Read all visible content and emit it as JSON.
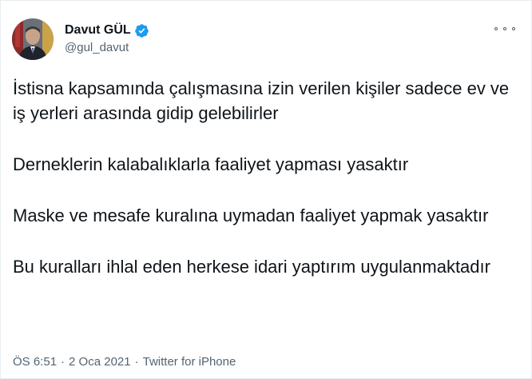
{
  "author": {
    "display_name": "Davut GÜL",
    "handle": "@gul_davut",
    "verified_badge_color": "#1d9bf0"
  },
  "more_icon": "more-horizontal-icon",
  "tweet": {
    "paragraphs": [
      "İstisna kapsamında çalışmasına izin verilen kişiler sadece ev ve iş yerleri arasında gidip gelebilirler",
      "Derneklerin kalabalıklarla faaliyet yapması yasaktır",
      "Maske ve mesafe kuralına uymadan faaliyet yapmak yasaktır",
      "Bu kuralları ihlal eden herkese idari yaptırım uygulanmaktadır"
    ],
    "time": "ÖS 6:51",
    "separator1": "·",
    "date": "2 Oca 2021",
    "separator2": "·",
    "source": "Twitter for iPhone"
  }
}
